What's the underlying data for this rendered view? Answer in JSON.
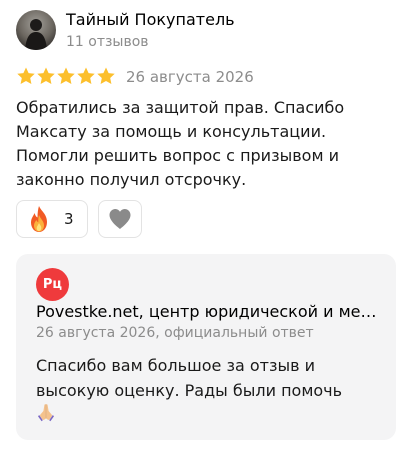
{
  "review": {
    "author_name": "Тайный Покупатель",
    "author_meta": "11 отзывов",
    "rating": 5,
    "date": "26 августа 2026",
    "text": "Обратились за защитой прав. Спасибо Максату за помощь и консультации. Помогли решить вопрос с призывом и законно получил отсрочку.",
    "reactions": {
      "fire_count": "3",
      "fire_icon": "fire-icon",
      "like_icon": "heart-icon"
    }
  },
  "answer": {
    "org_logo_text": "Рц",
    "org_name": "Povestke.net, центр юридической и медицинской помощи призывникам",
    "meta": "26 августа 2026, официальный ответ",
    "text": "Спасибо вам большое за отзыв и высокую оценку. Рады были помочь",
    "emoji_icon": "praying-hands-icon"
  },
  "colors": {
    "star": "#fcbf2c",
    "logo": "#ef3a3c",
    "answer_bg": "#f4f4f5",
    "muted_text": "#8c8c8c"
  }
}
